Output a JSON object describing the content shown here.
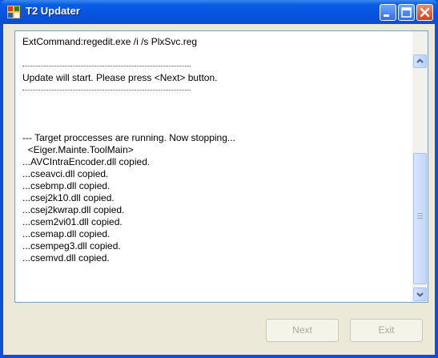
{
  "window": {
    "title": "T2 Updater"
  },
  "log": {
    "lines": [
      "ExtCommand:regedit.exe /i /s PlxSvc.reg",
      "",
      "",
      "Update will start. Please press <Next> button.",
      "",
      "",
      "",
      "",
      "--- Target proccesses are running. Now stopping...",
      "  <Eiger.Mainte.ToolMain>",
      "...AVCIntraEncoder.dll copied.",
      "...cseavci.dll copied.",
      "...csebmp.dll copied.",
      "...csej2k10.dll copied.",
      "...csej2kwrap.dll copied.",
      "...csem2vi01.dll copied.",
      "...csemap.dll copied.",
      "...csempeg3.dll copied.",
      "...csemvd.dll copied."
    ]
  },
  "buttons": {
    "next": "Next",
    "exit": "Exit"
  }
}
